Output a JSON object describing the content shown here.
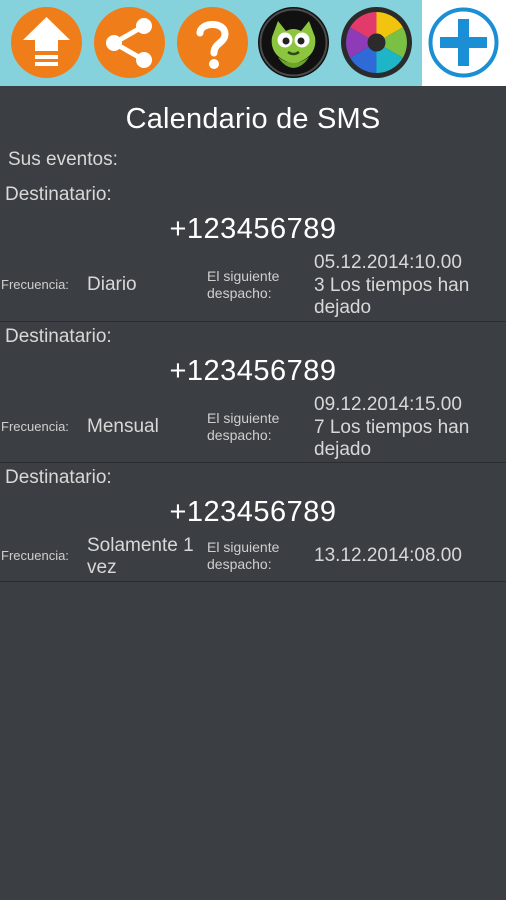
{
  "toolbar": {
    "buttons": [
      {
        "icon": "upload-arrow-icon",
        "color": "#ef7d1a"
      },
      {
        "icon": "share-icon",
        "color": "#ef7d1a"
      },
      {
        "icon": "help-question-icon",
        "color": "#ef7d1a"
      },
      {
        "icon": "green-owl-app-icon",
        "color": "#111111"
      },
      {
        "icon": "color-aperture-app-icon",
        "color": "#2b2b2b"
      },
      {
        "icon": "add-plus-icon",
        "color": "#1a8fd6"
      }
    ]
  },
  "title": "Calendario de SMS",
  "events_label": "Sus eventos:",
  "labels": {
    "recipient": "Destinatario:",
    "frequency": "Frecuencia:",
    "next_dispatch": "El siguiente despacho:"
  },
  "events": [
    {
      "phone": "+123456789",
      "frequency": "Diario",
      "next_date": "05.12.2014:10.00",
      "next_note": "3 Los tiempos han dejado"
    },
    {
      "phone": "+123456789",
      "frequency": "Mensual",
      "next_date": "09.12.2014:15.00",
      "next_note": "7 Los tiempos han dejado"
    },
    {
      "phone": "+123456789",
      "frequency": "Solamente 1 vez",
      "next_date": "13.12.2014:08.00",
      "next_note": ""
    }
  ]
}
